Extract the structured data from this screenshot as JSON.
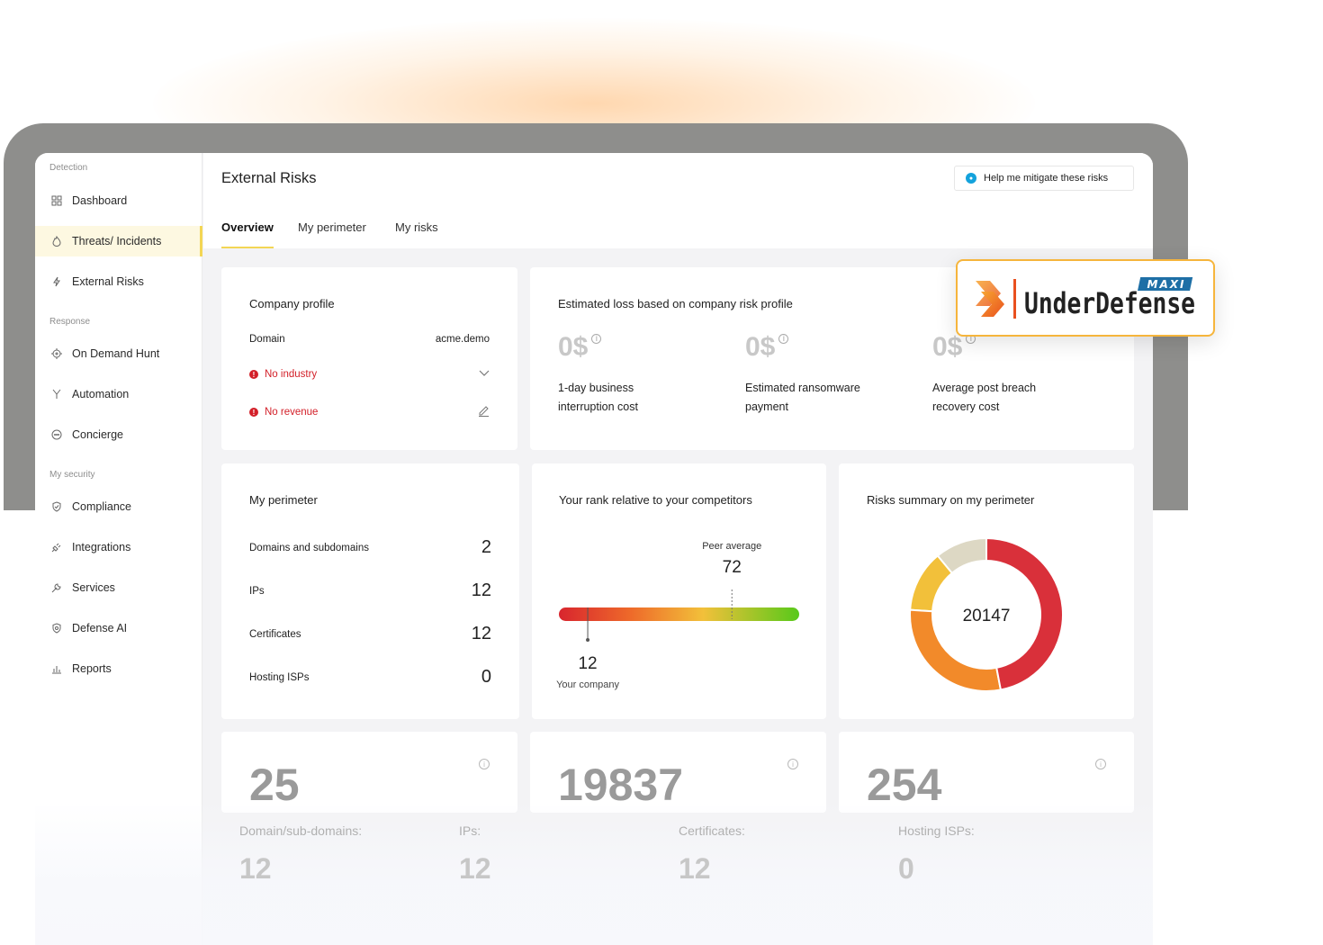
{
  "sidebar": {
    "sections": {
      "detection": "Detection",
      "response": "Response",
      "my_security": "My security"
    },
    "items": [
      {
        "label": "Dashboard",
        "icon": "grid-icon"
      },
      {
        "label": "Threats/ Incidents",
        "icon": "flame-icon",
        "active": true
      },
      {
        "label": "External Risks",
        "icon": "bolt-icon"
      },
      {
        "label": "On Demand Hunt",
        "icon": "crosshair-icon"
      },
      {
        "label": "Automation",
        "icon": "flow-icon"
      },
      {
        "label": "Concierge",
        "icon": "chat-icon"
      },
      {
        "label": "Compliance",
        "icon": "shield-check-icon"
      },
      {
        "label": "Integrations",
        "icon": "plug-icon"
      },
      {
        "label": "Services",
        "icon": "wrench-icon"
      },
      {
        "label": "Defense AI",
        "icon": "shield-ai-icon"
      },
      {
        "label": "Reports",
        "icon": "bar-chart-icon"
      }
    ]
  },
  "header": {
    "title": "External Risks",
    "help_button": "Help me mitigate these risks",
    "tabs": [
      "Overview",
      "My perimeter",
      "My risks"
    ]
  },
  "company_profile": {
    "title": "Company profile",
    "domain_label": "Domain",
    "domain_value": "acme.demo",
    "industry": "No industry",
    "revenue": "No revenue"
  },
  "estimated_loss": {
    "title": "Estimated loss based on company risk profile",
    "items": [
      {
        "amount": "0$",
        "label_line1": "1-day business",
        "label_line2": "interruption cost"
      },
      {
        "amount": "0$",
        "label_line1": "Estimated ransomware",
        "label_line2": "payment"
      },
      {
        "amount": "0$",
        "label_line1": "Average post breach",
        "label_line2": "recovery cost"
      }
    ]
  },
  "my_perimeter": {
    "title": "My perimeter",
    "rows": [
      {
        "label": "Domains and subdomains",
        "value": "2"
      },
      {
        "label": "IPs",
        "value": "12"
      },
      {
        "label": "Certificates",
        "value": "12"
      },
      {
        "label": "Hosting ISPs",
        "value": "0"
      }
    ]
  },
  "rank": {
    "title": "Your rank relative to your competitors",
    "peer_label": "Peer average",
    "peer_value": 72,
    "company_value": 12,
    "company_label": "Your company",
    "scale_max": 100
  },
  "risks_summary": {
    "title": "Risks summary on my perimeter",
    "total": "20147"
  },
  "chart_data": {
    "type": "pie",
    "title": "Risks summary on my perimeter",
    "center_label": "20147",
    "slices": [
      {
        "value": 0.47,
        "color": "#d9303a"
      },
      {
        "value": 0.29,
        "color": "#f28a2a"
      },
      {
        "value": 0.13,
        "color": "#f2c03a"
      },
      {
        "value": 0.11,
        "color": "#ddd8c4"
      }
    ]
  },
  "bottom_cards": [
    "25",
    "19837",
    "254"
  ],
  "bottom_stats": [
    {
      "label": "Domain/sub-domains:",
      "value": "12"
    },
    {
      "label": "IPs:",
      "value": "12"
    },
    {
      "label": "Certificates:",
      "value": "12"
    },
    {
      "label": "Hosting ISPs:",
      "value": "0"
    }
  ],
  "logo": {
    "text": "UnderDefense",
    "badge": "MAXI"
  },
  "colors": {
    "accent": "#f3d655",
    "danger": "#d32029",
    "info": "#13a2dc"
  }
}
